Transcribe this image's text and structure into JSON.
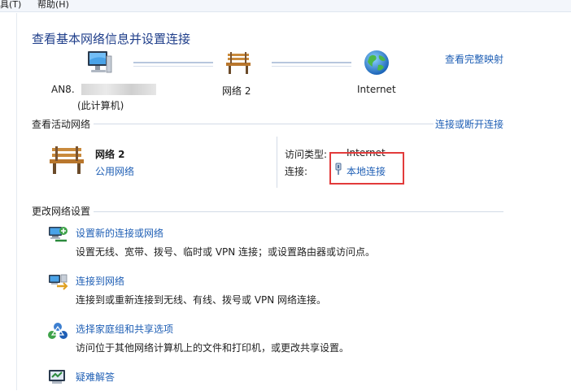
{
  "menubar": {
    "tools_partial": "具(T)",
    "help": "帮助(H)"
  },
  "page": {
    "title": "查看基本网络信息并设置连接",
    "full_map_link": "查看完整映射"
  },
  "network_map": {
    "computer_name": "AN8.",
    "computer_sub": "(此计算机)",
    "network_name": "网络  2",
    "internet_name": "Internet"
  },
  "active_networks": {
    "section_title": "查看活动网络",
    "connect_disconnect_link": "连接或断开连接",
    "network_name": "网络  2",
    "network_type": "公用网络",
    "access_type_label": "访问类型:",
    "access_type_value": "Internet",
    "connections_label": "连接:",
    "connection_value": "本地连接"
  },
  "change_settings": {
    "section_title": "更改网络设置",
    "tasks": [
      {
        "title": "设置新的连接或网络",
        "desc": "设置无线、宽带、拨号、临时或 VPN 连接；或设置路由器或访问点。"
      },
      {
        "title": "连接到网络",
        "desc": "连接到或重新连接到无线、有线、拨号或 VPN 网络连接。"
      },
      {
        "title": "选择家庭组和共享选项",
        "desc": "访问位于其他网络计算机上的文件和打印机，或更改共享设置。"
      },
      {
        "title": "疑难解答",
        "desc": ""
      }
    ]
  },
  "colors": {
    "link": "#1f5fb5",
    "title": "#1f3e8a",
    "highlight": "#e23b3b"
  }
}
